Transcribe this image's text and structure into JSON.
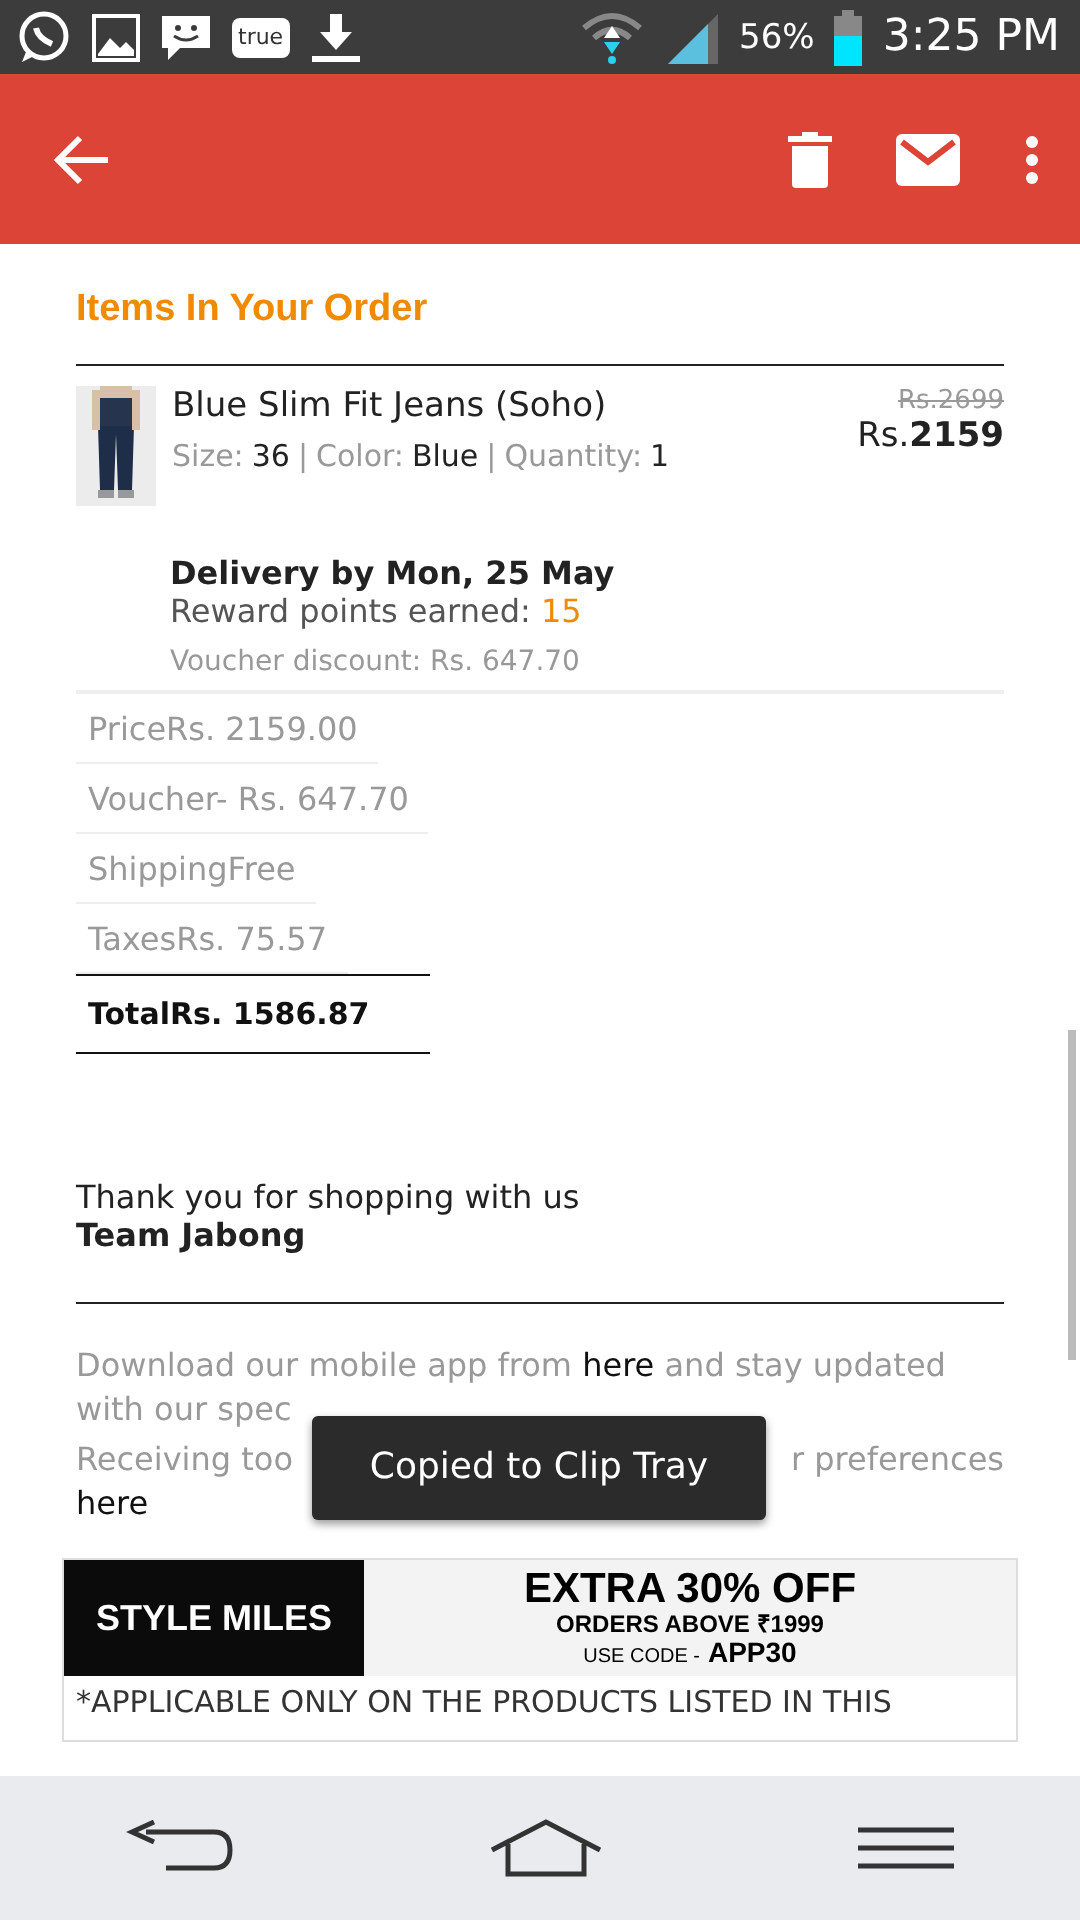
{
  "status_bar": {
    "app_badge": "true",
    "battery": "56%",
    "time": "3:25 PM"
  },
  "heading": "Items In Your Order",
  "item": {
    "name": "Blue Slim Fit Jeans (Soho)",
    "attributes": [
      {
        "label": "Size:",
        "value": "36"
      },
      {
        "label": "Color:",
        "value": "Blue"
      },
      {
        "label": "Quantity:",
        "value": "1"
      }
    ],
    "separator": "|",
    "old_price": "Rs.2699",
    "price_prefix": "Rs.",
    "price": "2159",
    "delivery": "Delivery by Mon, 25 May",
    "reward_label": "Reward points earned:",
    "reward_points": "15",
    "voucher_note": "Voucher discount: Rs. 647.70"
  },
  "summary": [
    {
      "kind": "line",
      "label": "Price",
      "value": "Rs. 2159.00"
    },
    {
      "kind": "line",
      "label": "Voucher",
      "value": "- Rs. 647.70"
    },
    {
      "kind": "line",
      "label": "Shipping",
      "value": "Free"
    },
    {
      "kind": "line",
      "label": "Taxes",
      "value": "Rs. 75.57"
    },
    {
      "kind": "total",
      "label": "Total",
      "value": "Rs. 1586.87"
    }
  ],
  "thanks": "Thank you for shopping with us",
  "signature": "Team Jabong",
  "app_note": {
    "before": "Download our mobile app from",
    "link": "here",
    "after": "and stay updated",
    "line2": "with our spec"
  },
  "prefs_note": {
    "start": "Receiving too",
    "end": "r preferences",
    "link": "here"
  },
  "toast": "Copied to Clip Tray",
  "banner": {
    "brand": "STYLE MILES",
    "offer": "EXTRA 30% OFF",
    "condition": "ORDERS ABOVE ₹1999",
    "code_label": "USE CODE -",
    "code": "APP30",
    "fine_print": "*APPLICABLE ONLY ON THE PRODUCTS LISTED IN THIS"
  }
}
